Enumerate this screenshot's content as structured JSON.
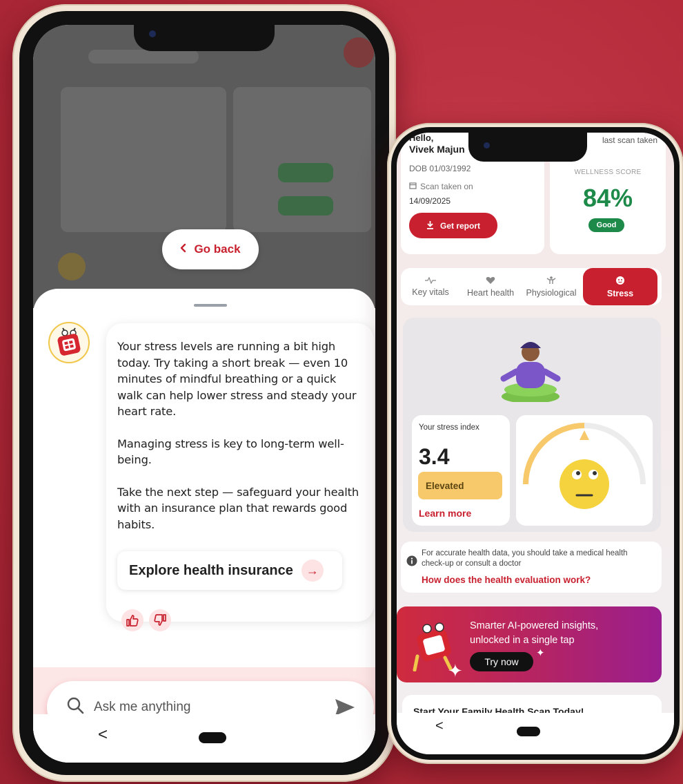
{
  "chat_screen": {
    "go_back_label": "Go back",
    "go_back_icon": "chevron-left-icon",
    "message_paragraphs": [
      "Your stress levels are running a bit high today. Try taking a short break — even 10 minutes of mindful breathing or a quick walk can help lower stress and steady your heart rate.",
      "Managing stress is key to long-term well-being.",
      "Take the next step — safeguard your health with an insurance plan that rewards good habits."
    ],
    "cta_label": "Explore health insurance",
    "cta_icon": "arrow-right-icon",
    "feedback_icons": [
      "thumbs-up-icon",
      "thumbs-down-icon"
    ],
    "ask_placeholder": "Ask me anything",
    "nav_back_glyph": "<"
  },
  "dashboard_screen": {
    "greeting": "Hello,",
    "user_name": "Vivek Majun",
    "last_scan_label": "last scan taken",
    "dob": "DOB 01/03/1992",
    "scan_label": "Scan taken on",
    "scan_date": "14/09/2025",
    "get_report_label": "Get report",
    "wellness_label": "WELLNESS SCORE",
    "wellness_value": "84%",
    "wellness_status": "Good",
    "tabs": [
      {
        "label": "Key vitals",
        "icon": "pulse-icon"
      },
      {
        "label": "Heart health",
        "icon": "heart-icon"
      },
      {
        "label": "Physiological",
        "icon": "body-icon"
      },
      {
        "label": "Stress",
        "icon": "face-icon"
      }
    ],
    "stress_index_label": "Your stress index",
    "stress_index_value": "3.4",
    "stress_level": "Elevated",
    "stress_gauge_fraction": 0.5,
    "learn_more_label": "Learn more",
    "disclaimer": "For accurate health data, you should take a medical health check-up or consult a doctor",
    "evaluation_link": "How does the health evaluation work?",
    "promo_text": "Smarter AI-powered insights, unlocked in a single tap",
    "try_now_label": "Try now",
    "family_scan_label": "Start Your Family Health Scan Today!",
    "nav_back_glyph": "<"
  },
  "colors": {
    "brand_red": "#c8202e",
    "background_red": "#b52b3a",
    "good_green": "#1e8a4a",
    "elevated_yellow": "#f7c96a",
    "promo_purple": "#9a1e8f"
  }
}
